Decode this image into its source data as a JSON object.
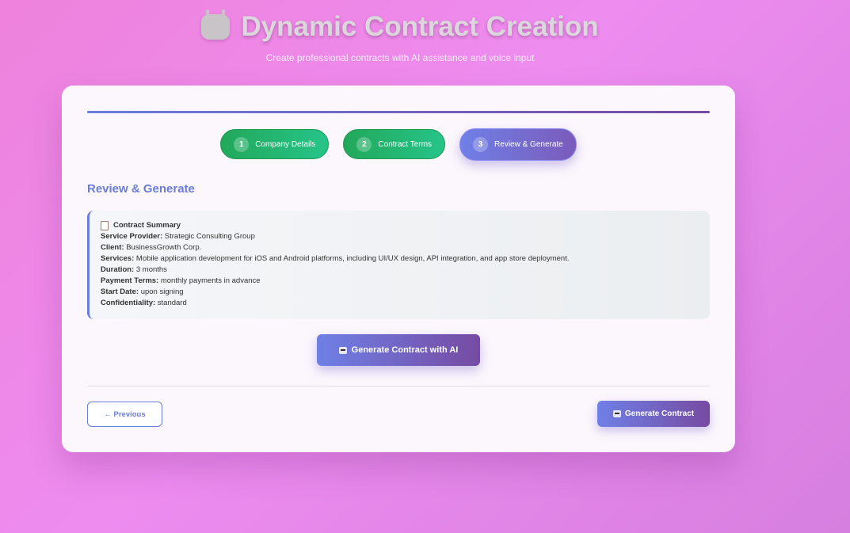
{
  "header": {
    "title": "Dynamic Contract Creation",
    "subtitle": "Create professional contracts with AI assistance and voice input"
  },
  "steps": [
    {
      "number": "1",
      "label": "Company Details",
      "status": "completed"
    },
    {
      "number": "2",
      "label": "Contract Terms",
      "status": "completed"
    },
    {
      "number": "3",
      "label": "Review & Generate",
      "status": "active"
    }
  ],
  "section_title": "Review & Generate",
  "summary": {
    "heading": "Contract Summary",
    "rows": [
      {
        "label": "Service Provider:",
        "value": "Strategic Consulting Group"
      },
      {
        "label": "Client:",
        "value": "BusinessGrowth Corp."
      },
      {
        "label": "Services:",
        "value": "Mobile application development for iOS and Android platforms, including UI/UX design, API integration, and app store deployment."
      },
      {
        "label": "Duration:",
        "value": "3 months"
      },
      {
        "label": "Payment Terms:",
        "value": "monthly payments in advance"
      },
      {
        "label": "Start Date:",
        "value": "upon signing"
      },
      {
        "label": "Confidentiality:",
        "value": "standard"
      }
    ]
  },
  "actions": {
    "generate_ai_label": "Generate Contract with AI",
    "previous_label": "← Previous",
    "generate_label": "Generate Contract"
  },
  "colors": {
    "accent": "#6a7dd8",
    "accent_end": "#764ba2",
    "completed": "#22a85a"
  }
}
